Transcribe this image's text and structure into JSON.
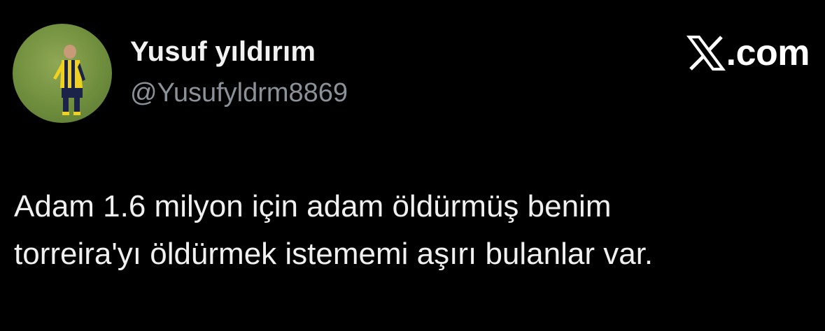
{
  "tweet": {
    "display_name": "Yusuf yıldırım",
    "handle": "@Yusufyldrm8869",
    "text_lines": [
      "Adam 1.6 milyon için adam öldürmüş benim",
      "torreira'yı öldürmek istememi aşırı bulanlar var."
    ]
  },
  "brand": {
    "icon": "x-logo-icon",
    "domain_suffix": ".com"
  },
  "avatar": {
    "icon": "avatar-photo",
    "colors": {
      "pitch": "#6f8e3d",
      "jersey_yellow": "#f0d020",
      "jersey_navy": "#1b2448"
    }
  },
  "colors": {
    "background": "#000000",
    "name": "#f2f2f2",
    "handle": "#8b9199",
    "text": "#f0f0f0"
  }
}
